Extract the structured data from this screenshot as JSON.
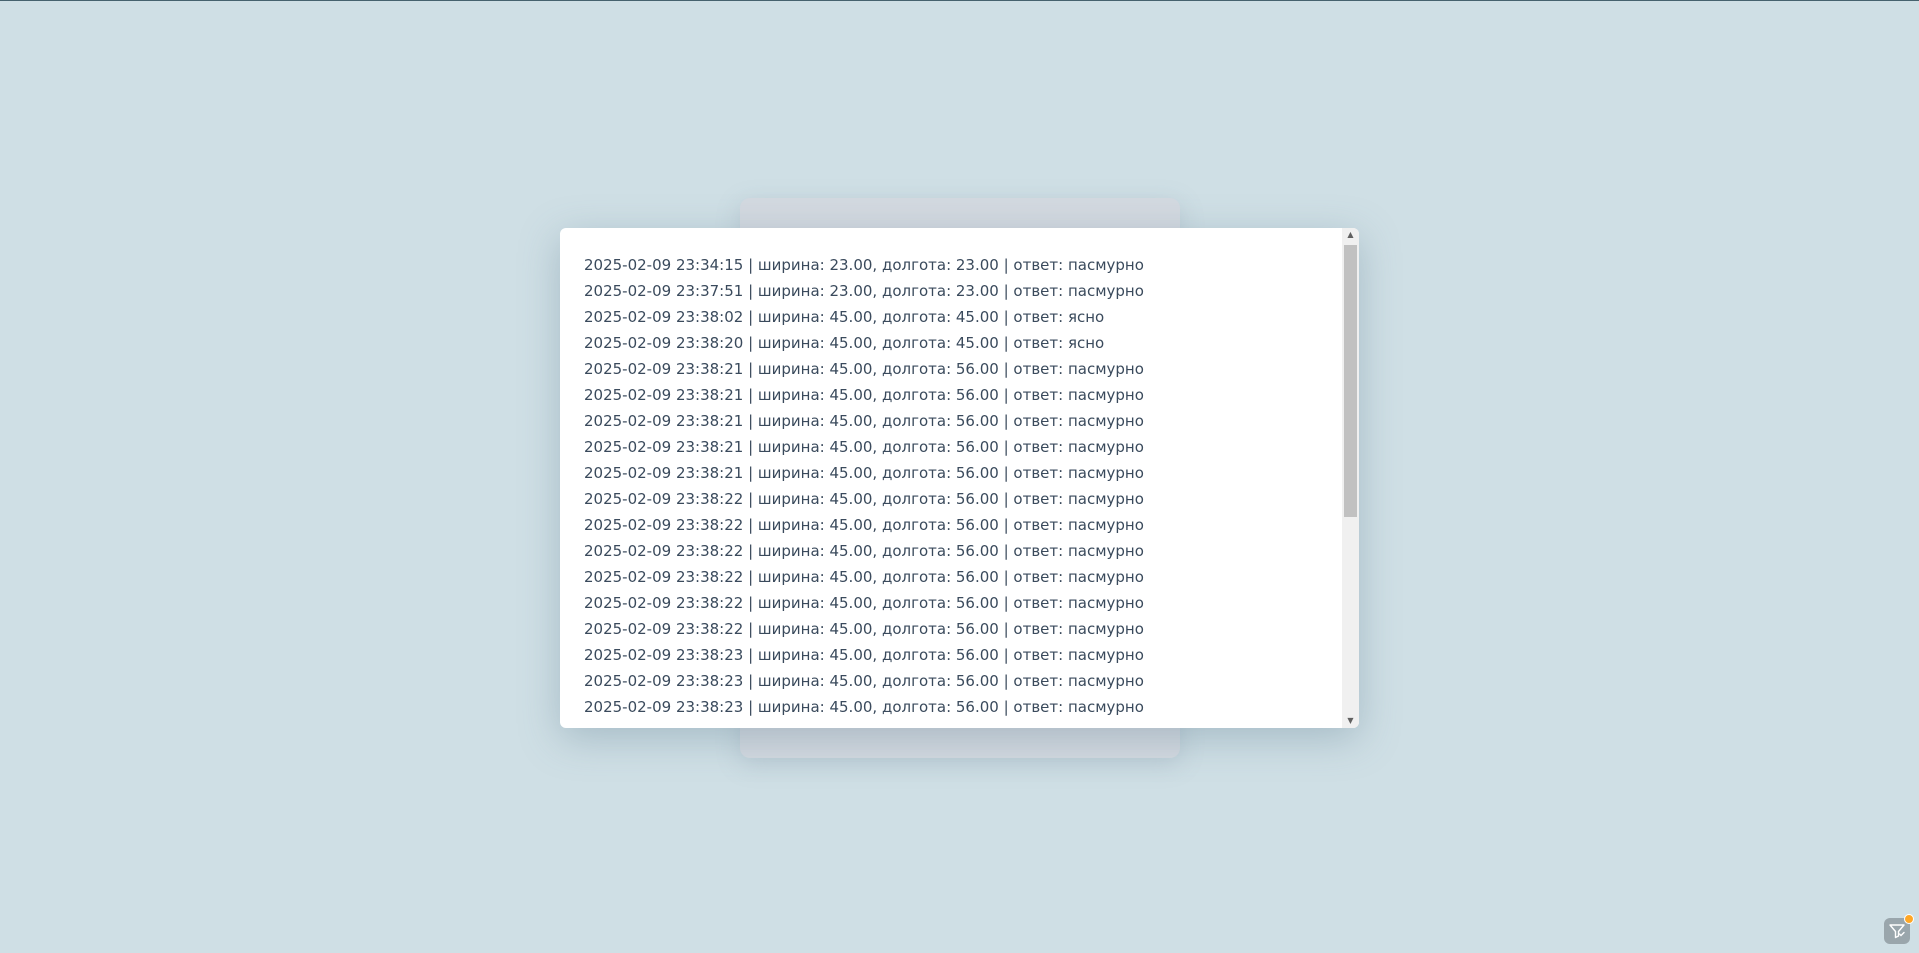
{
  "log": {
    "entries": [
      "2025-02-09 23:34:15 | ширина: 23.00, долгота: 23.00 | ответ: пасмурно",
      "2025-02-09 23:37:51 | ширина: 23.00, долгота: 23.00 | ответ: пасмурно",
      "2025-02-09 23:38:02 | ширина: 45.00, долгота: 45.00 | ответ: ясно",
      "2025-02-09 23:38:20 | ширина: 45.00, долгота: 45.00 | ответ: ясно",
      "2025-02-09 23:38:21 | ширина: 45.00, долгота: 56.00 | ответ: пасмурно",
      "2025-02-09 23:38:21 | ширина: 45.00, долгота: 56.00 | ответ: пасмурно",
      "2025-02-09 23:38:21 | ширина: 45.00, долгота: 56.00 | ответ: пасмурно",
      "2025-02-09 23:38:21 | ширина: 45.00, долгота: 56.00 | ответ: пасмурно",
      "2025-02-09 23:38:21 | ширина: 45.00, долгота: 56.00 | ответ: пасмурно",
      "2025-02-09 23:38:22 | ширина: 45.00, долгота: 56.00 | ответ: пасмурно",
      "2025-02-09 23:38:22 | ширина: 45.00, долгота: 56.00 | ответ: пасмурно",
      "2025-02-09 23:38:22 | ширина: 45.00, долгота: 56.00 | ответ: пасмурно",
      "2025-02-09 23:38:22 | ширина: 45.00, долгота: 56.00 | ответ: пасмурно",
      "2025-02-09 23:38:22 | ширина: 45.00, долгота: 56.00 | ответ: пасмурно",
      "2025-02-09 23:38:22 | ширина: 45.00, долгота: 56.00 | ответ: пасмурно",
      "2025-02-09 23:38:23 | ширина: 45.00, долгота: 56.00 | ответ: пасмурно",
      "2025-02-09 23:38:23 | ширина: 45.00, долгота: 56.00 | ответ: пасмурно",
      "2025-02-09 23:38:23 | ширина: 45.00, долгота: 56.00 | ответ: пасмурно"
    ]
  },
  "scrollbar": {
    "up_icon": "scroll-up-arrow-icon",
    "down_icon": "scroll-down-arrow-icon"
  },
  "corner_widget": {
    "icon": "filter-check-icon",
    "badge_color": "#ffa726"
  }
}
